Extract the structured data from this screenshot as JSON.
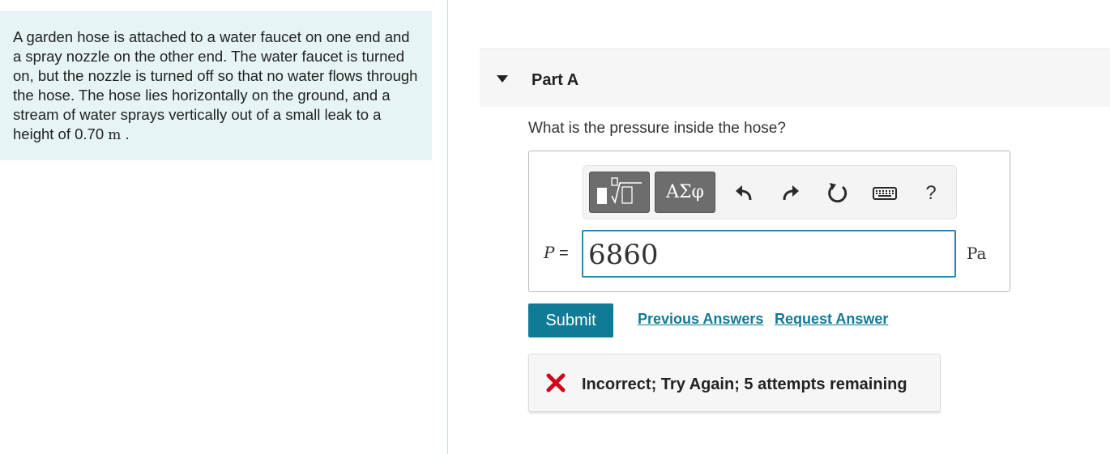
{
  "problem": {
    "text_before_unit": "A garden hose is attached to a water faucet on one end and a spray nozzle on the other end. The water faucet is turned on, but the nozzle is turned off so that no water flows through the hose. The hose lies horizontally on the ground, and a stream of water sprays vertically out of a small leak to a height of 0.70",
    "unit": "m",
    "text_after_unit": " ."
  },
  "part": {
    "title": "Part A",
    "question": "What is the pressure inside the hose?"
  },
  "toolbar": {
    "symbols_label": "ΑΣφ",
    "help_label": "?"
  },
  "answer": {
    "variable": "P",
    "equals": " =",
    "value": "6860",
    "unit": "Pa"
  },
  "actions": {
    "submit_label": "Submit",
    "previous_answers_label": "Previous Answers",
    "request_answer_label": "Request Answer"
  },
  "feedback": {
    "message": "Incorrect; Try Again; 5 attempts remaining",
    "icon": "x-mark-icon"
  },
  "colors": {
    "accent": "#0f7b95",
    "input_border": "#2e86ab",
    "error": "#d0021b",
    "problem_bg": "#e6f4f5",
    "toolbar_button": "#6d6d6d"
  }
}
